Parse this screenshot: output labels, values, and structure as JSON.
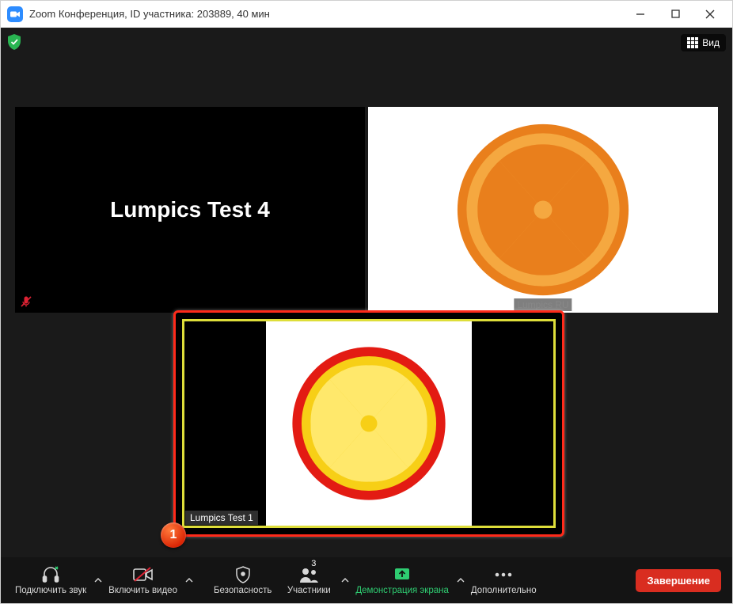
{
  "window": {
    "title": "Zoom Конференция, ID участника: 203889, 40 мин"
  },
  "top": {
    "view_label": "Вид"
  },
  "tiles": {
    "left_name": "Lumpics Test 4",
    "right_tag": "Lumpics RU"
  },
  "highlight": {
    "name": "Lumpics Test 1",
    "step": "1"
  },
  "toolbar": {
    "audio": "Подключить звук",
    "video": "Включить видео",
    "security": "Безопасность",
    "participants": "Участники",
    "participants_count": "3",
    "share": "Демонстрация экрана",
    "more": "Дополнительно",
    "end": "Завершение"
  }
}
